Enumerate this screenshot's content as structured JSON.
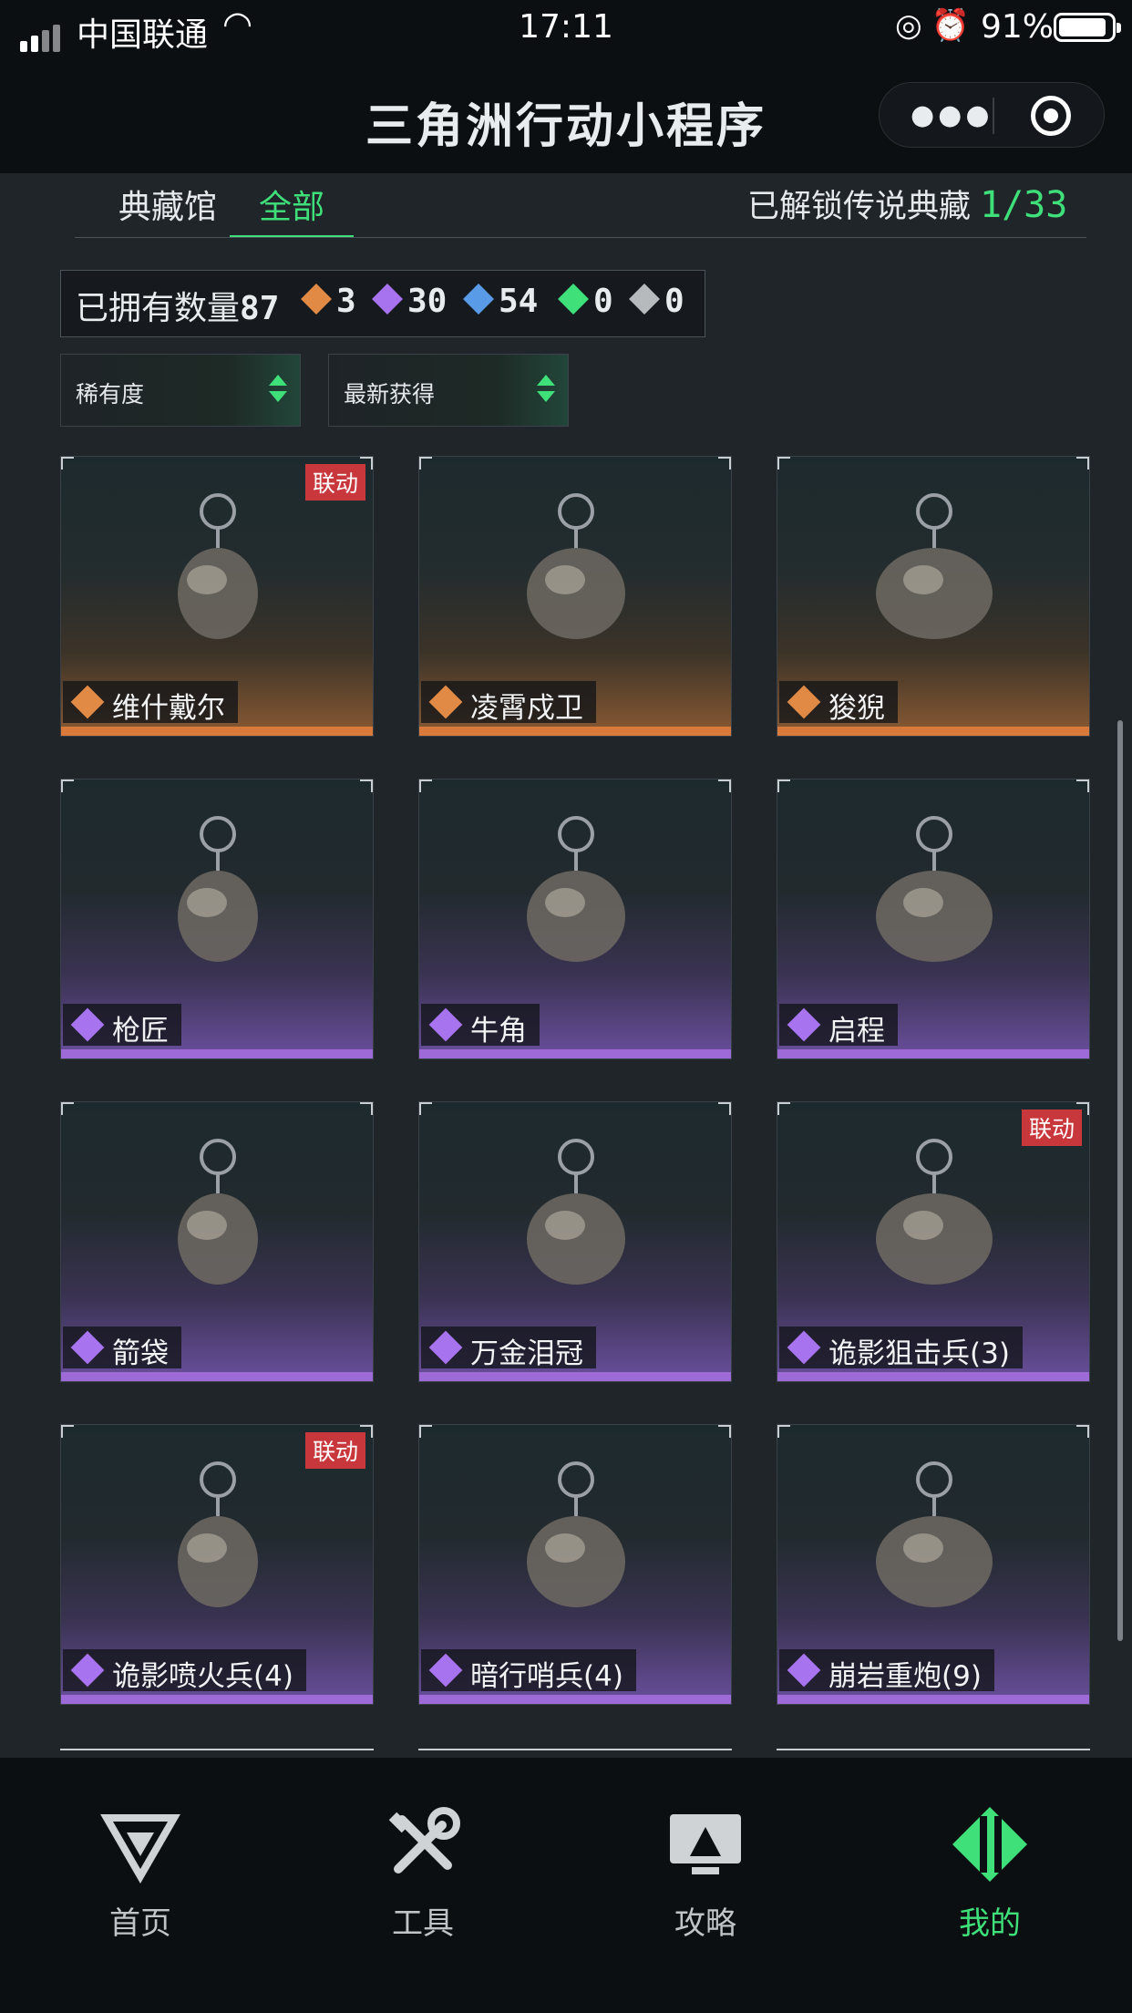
{
  "status_bar": {
    "carrier": "中国联通",
    "time": "17:11",
    "battery_pct": "91%",
    "battery_level": 0.91
  },
  "header": {
    "title": "三角洲行动小程序"
  },
  "tabs": [
    {
      "label": "典藏馆",
      "active": false
    },
    {
      "label": "全部",
      "active": true
    }
  ],
  "unlock": {
    "label": "已解锁传说典藏",
    "value": "1/33"
  },
  "counts": {
    "label": "已拥有数量",
    "total": "87",
    "tiers": [
      {
        "value": "3",
        "color": "#e08a45"
      },
      {
        "value": "30",
        "color": "#a873ee"
      },
      {
        "value": "54",
        "color": "#5a9be8"
      },
      {
        "value": "0",
        "color": "#3fe07a"
      },
      {
        "value": "0",
        "color": "#b6babd"
      }
    ]
  },
  "filters": {
    "rarity": "稀有度",
    "sort": "最新获得"
  },
  "items": [
    {
      "name": "维什戴尔",
      "rarity": "legendary",
      "tag": "联动"
    },
    {
      "name": "凌霄戍卫",
      "rarity": "legendary",
      "tag": ""
    },
    {
      "name": "狻猊",
      "rarity": "legendary",
      "tag": ""
    },
    {
      "name": "枪匠",
      "rarity": "epic",
      "tag": ""
    },
    {
      "name": "牛角",
      "rarity": "epic",
      "tag": ""
    },
    {
      "name": "启程",
      "rarity": "epic",
      "tag": ""
    },
    {
      "name": "箭袋",
      "rarity": "epic",
      "tag": ""
    },
    {
      "name": "万金泪冠",
      "rarity": "epic",
      "tag": ""
    },
    {
      "name": "诡影狙击兵(3)",
      "rarity": "epic",
      "tag": "联动"
    },
    {
      "name": "诡影喷火兵(4)",
      "rarity": "epic",
      "tag": "联动"
    },
    {
      "name": "暗行哨兵(4)",
      "rarity": "epic",
      "tag": ""
    },
    {
      "name": "崩岩重炮(9)",
      "rarity": "epic",
      "tag": ""
    }
  ],
  "nav": [
    {
      "label": "首页",
      "icon": "home-logo-icon",
      "active": false
    },
    {
      "label": "工具",
      "icon": "tools-icon",
      "active": false
    },
    {
      "label": "攻略",
      "icon": "guide-monitor-icon",
      "active": false
    },
    {
      "label": "我的",
      "icon": "profile-diamond-icon",
      "active": true
    }
  ],
  "colors": {
    "accent": "#3fe07a",
    "legendary": "#e08a45",
    "epic": "#a873ee",
    "collab_tag": "#c8373b"
  }
}
